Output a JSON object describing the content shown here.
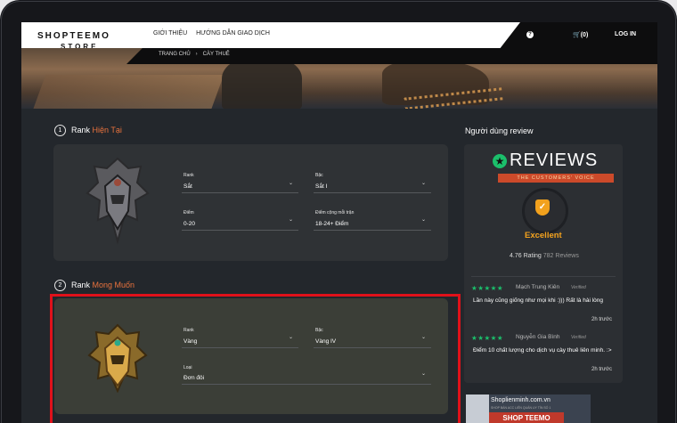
{
  "header": {
    "logo_top": "SHOPTEEMO",
    "logo_bottom": "STORE",
    "nav": [
      "GIỚI THIỆU",
      "HƯỚNG DẪN GIAO DỊCH"
    ],
    "cart_label": "(0)",
    "login_label": "LOG IN"
  },
  "breadcrumb": {
    "home": "TRANG CHỦ",
    "current": "CÀY THUÊ"
  },
  "section1": {
    "number": "1",
    "title_prefix": "Rank",
    "title_accent": "Hiện Tại",
    "fields": [
      {
        "label": "Rank",
        "value": "Sắt"
      },
      {
        "label": "Bậc",
        "value": "Sắt I"
      },
      {
        "label": "Điểm",
        "value": "0-20"
      },
      {
        "label": "Điểm cộng mỗi trận",
        "value": "18-24+ Điểm"
      }
    ]
  },
  "section2": {
    "number": "2",
    "title_prefix": "Rank",
    "title_accent": "Mong Muốn",
    "fields": [
      {
        "label": "Rank",
        "value": "Vàng"
      },
      {
        "label": "Bậc",
        "value": "Vàng IV"
      },
      {
        "label": "Loại",
        "value": "Đơn đôi"
      }
    ]
  },
  "reviews": {
    "panel_title": "Người dùng review",
    "brand": "REVIEWS",
    "ribbon": "THE CUSTOMERS' VOICE",
    "verdict": "Excellent",
    "rating_text": "4.76 Rating",
    "count_text": "782 Reviews",
    "items": [
      {
        "stars": "★★★★★",
        "name": "Mạch Trung Kiên",
        "verified": "Verified",
        "text": "Lần này cũng giống như mọi khi :))) Rất là hài lòng",
        "time": "2h trước"
      },
      {
        "stars": "★★★★★",
        "name": "Nguyễn Gia Bình",
        "verified": "Verified",
        "text": "Điểm 10 chất lượng cho dịch vụ cày thuê liên minh. :>",
        "time": "2h trước"
      }
    ]
  },
  "ad": {
    "site": "Shoplienminh.com.vn",
    "tagline": "SHOP BÁN ACC LIÊN QUÂN UY TÍN SỐ 1",
    "banner_text": "SHOP TEEMO"
  },
  "colors": {
    "accent": "#e8723d",
    "review_green": "#1bbf6b",
    "highlight_red": "#e0111a",
    "excellent": "#f2a11d"
  },
  "icons": [
    "help-icon",
    "cart-icon",
    "chevron-down-icon",
    "iron-rank-emblem",
    "gold-rank-emblem",
    "star-icon",
    "shield-check-icon"
  ]
}
